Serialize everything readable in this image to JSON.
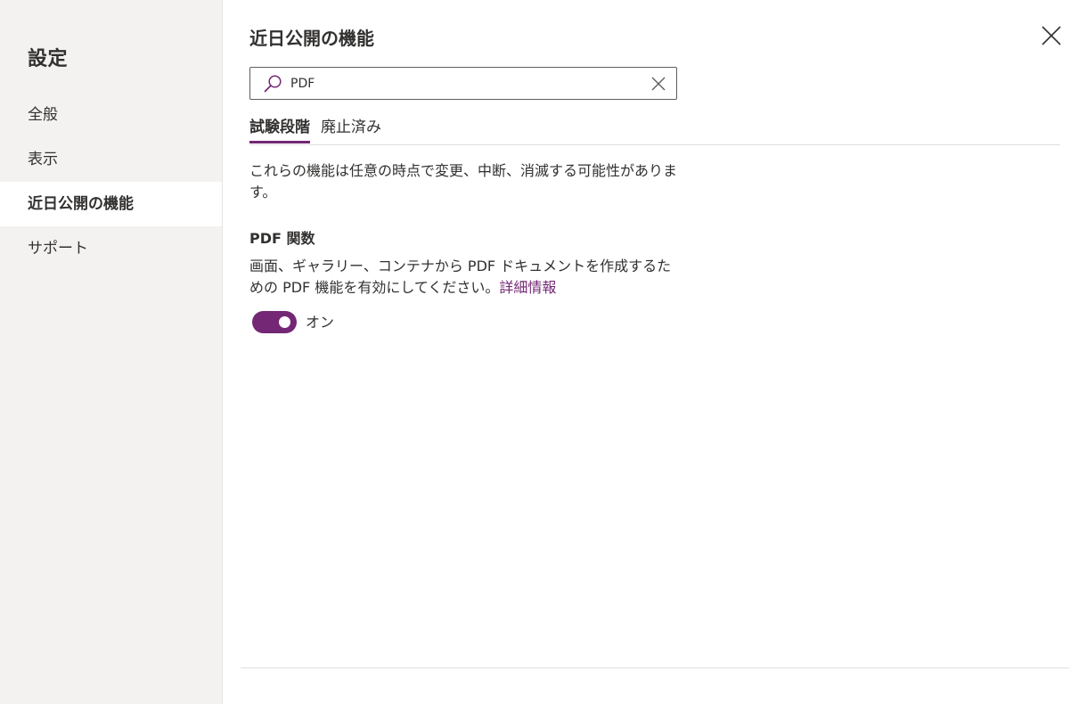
{
  "sidebar": {
    "title": "設定",
    "items": [
      {
        "label": "全般",
        "active": false
      },
      {
        "label": "表示",
        "active": false
      },
      {
        "label": "近日公開の機能",
        "active": true
      },
      {
        "label": "サポート",
        "active": false
      }
    ]
  },
  "main": {
    "title": "近日公開の機能",
    "search": {
      "value": "PDF",
      "icon": "search-icon"
    },
    "tabs": [
      {
        "label": "試験段階",
        "active": true
      },
      {
        "label": "廃止済み",
        "active": false
      }
    ],
    "description": "これらの機能は任意の時点で変更、中断、消滅する可能性があります。",
    "feature": {
      "title": "PDF 関数",
      "description": "画面、ギャラリー、コンテナから PDF ドキュメントを作成するための PDF 機能を有効にしてください。",
      "link_label": "詳細情報",
      "toggle_state": true,
      "toggle_label": "オン"
    }
  },
  "colors": {
    "accent": "#742774",
    "sidebar_bg": "#f3f2f1",
    "text": "#323130"
  }
}
